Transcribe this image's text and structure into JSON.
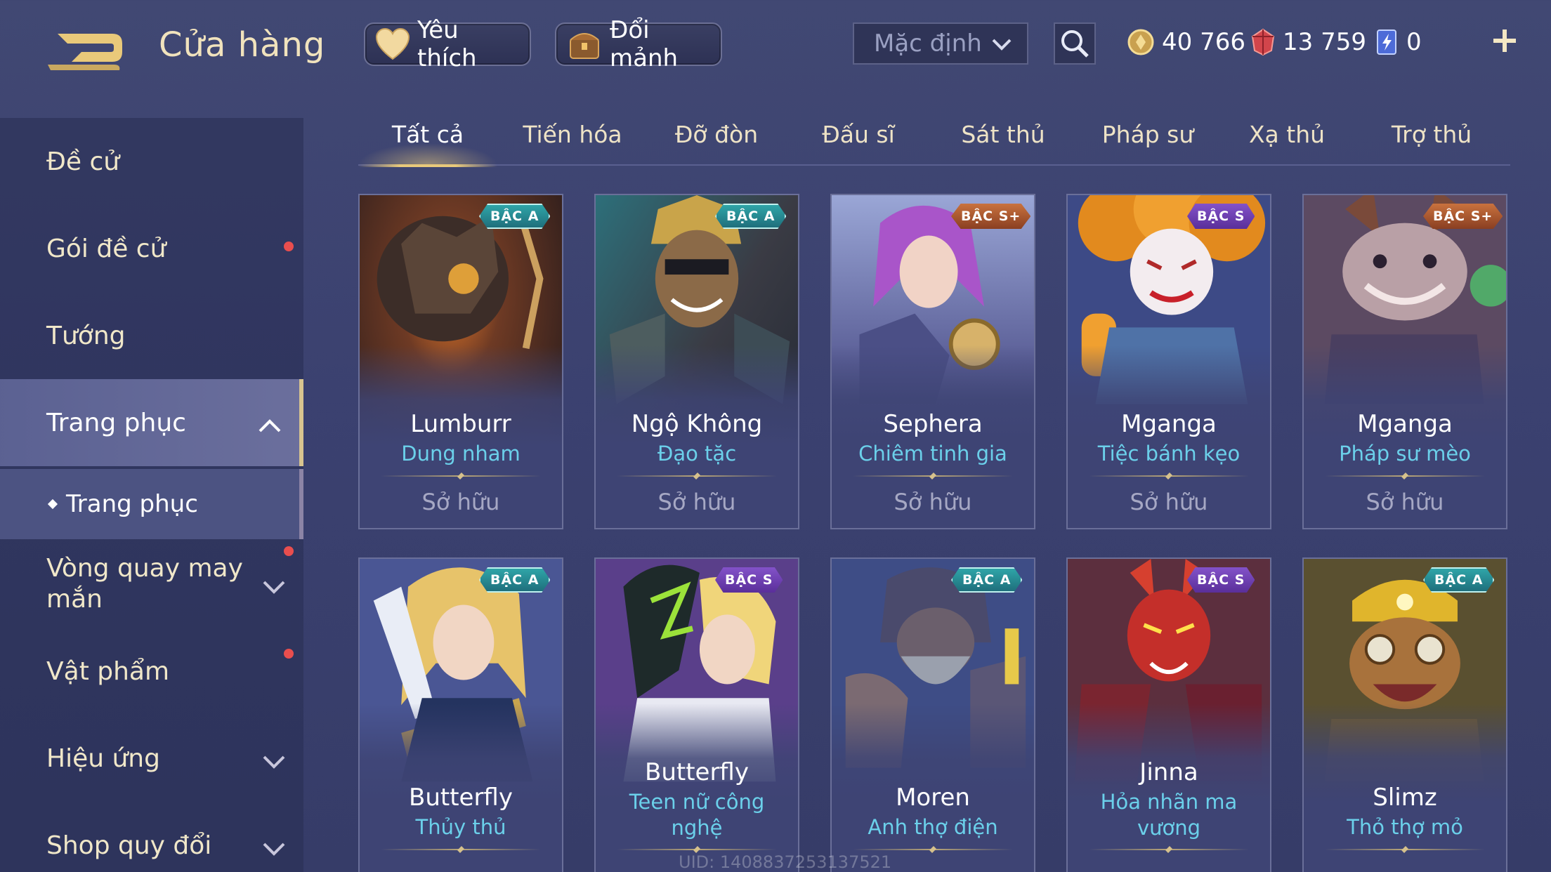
{
  "header": {
    "title": "Cửa hàng",
    "favorites_label": "Yêu thích",
    "fragments_label": "Đổi mảnh",
    "sort_value": "Mặc định"
  },
  "currencies": {
    "gold": "40 766",
    "gems": "13 759",
    "tickets": "0"
  },
  "sidebar": {
    "items": [
      {
        "label": "Đề cử"
      },
      {
        "label": "Gói đề cử"
      },
      {
        "label": "Tướng"
      },
      {
        "label": "Trang phục"
      },
      {
        "label": "Trang phục"
      },
      {
        "label": "Vòng quay may mắn"
      },
      {
        "label": "Vật phẩm"
      },
      {
        "label": "Hiệu ứng"
      },
      {
        "label": "Shop quy đổi"
      }
    ]
  },
  "tabs": [
    {
      "label": "Tất cả"
    },
    {
      "label": "Tiến hóa"
    },
    {
      "label": "Đỡ đòn"
    },
    {
      "label": "Đấu sĩ"
    },
    {
      "label": "Sát thủ"
    },
    {
      "label": "Pháp sư"
    },
    {
      "label": "Xạ thủ"
    },
    {
      "label": "Trợ thủ"
    }
  ],
  "cards": [
    {
      "hero": "Lumburr",
      "skin": "Dung nham",
      "rank": "BẬC A",
      "status": "Sở hữu"
    },
    {
      "hero": "Ngộ Không",
      "skin": "Đạo tặc",
      "rank": "BẬC A",
      "status": "Sở hữu"
    },
    {
      "hero": "Sephera",
      "skin": "Chiêm tinh gia",
      "rank": "BẬC S+",
      "status": "Sở hữu"
    },
    {
      "hero": "Mganga",
      "skin": "Tiệc bánh kẹo",
      "rank": "BẬC S",
      "status": "Sở hữu"
    },
    {
      "hero": "Mganga",
      "skin": "Pháp sư mèo",
      "rank": "BẬC S+",
      "status": "Sở hữu"
    },
    {
      "hero": "Butterfly",
      "skin": "Thủy thủ",
      "rank": "BẬC A",
      "status": ""
    },
    {
      "hero": "Butterfly",
      "skin": "Teen nữ công nghệ",
      "rank": "BẬC S",
      "status": ""
    },
    {
      "hero": "Moren",
      "skin": "Anh thợ điện",
      "rank": "BẬC A",
      "status": ""
    },
    {
      "hero": "Jinna",
      "skin": "Hỏa nhãn ma vương",
      "rank": "BẬC S",
      "status": ""
    },
    {
      "hero": "Slimz",
      "skin": "Thỏ thợ mỏ",
      "rank": "BẬC A",
      "status": ""
    }
  ],
  "footer": {
    "uid": "UID: 1408837253137521"
  },
  "colors": {
    "accent_gold": "#e8c97b",
    "skin_name_cyan": "#6bd0ea",
    "notification_red": "#e94e4e"
  }
}
